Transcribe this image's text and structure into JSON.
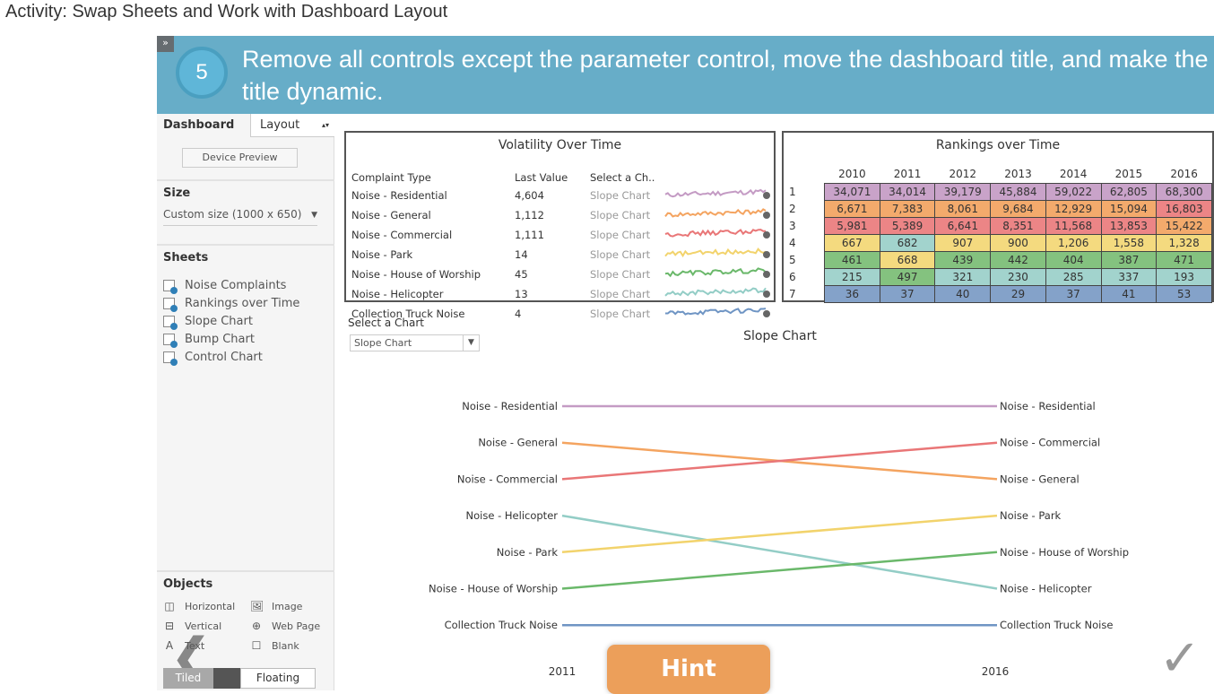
{
  "activity_title": "Activity: Swap Sheets and Work with Dashboard Layout",
  "step": {
    "number": "5",
    "instruction": "Remove all controls except the parameter control, move the dashboard title, and make the title dynamic.",
    "expand_icon": "double-chevron-right"
  },
  "sidebar": {
    "tabs": [
      "Dashboard",
      "Layout"
    ],
    "device_preview": "Device Preview",
    "size_label": "Size",
    "size_value": "Custom size (1000 x 650)",
    "sheets_label": "Sheets",
    "sheets": [
      "Noise Complaints",
      "Rankings over Time",
      "Slope Chart",
      "Bump Chart",
      "Control Chart"
    ],
    "objects_label": "Objects",
    "objects": [
      {
        "label": "Horizontal",
        "icon": "horizontal-container"
      },
      {
        "label": "Image",
        "icon": "image"
      },
      {
        "label": "Vertical",
        "icon": "vertical-container"
      },
      {
        "label": "Web Page",
        "icon": "globe"
      },
      {
        "label": "Text",
        "icon": "text"
      },
      {
        "label": "Blank",
        "icon": "blank"
      }
    ],
    "tiled": "Tiled",
    "floating": "Floating"
  },
  "volatility": {
    "title": "Volatility Over Time",
    "headers": [
      "Complaint Type",
      "Last Value",
      "Select a Ch.."
    ],
    "rows": [
      {
        "type": "Noise - Residential",
        "last": "4,604",
        "chart": "Slope Chart",
        "color": "#c49bc4"
      },
      {
        "type": "Noise - General",
        "last": "1,112",
        "chart": "Slope Chart",
        "color": "#f4a460"
      },
      {
        "type": "Noise - Commercial",
        "last": "1,111",
        "chart": "Slope Chart",
        "color": "#e97677"
      },
      {
        "type": "Noise - Park",
        "last": "14",
        "chart": "Slope Chart",
        "color": "#f2d36c"
      },
      {
        "type": "Noise - House of Worship",
        "last": "45",
        "chart": "Slope Chart",
        "color": "#6ab86a"
      },
      {
        "type": "Noise - Helicopter",
        "last": "13",
        "chart": "Slope Chart",
        "color": "#93cdc6"
      },
      {
        "type": "Collection Truck Noise",
        "last": "4",
        "chart": "Slope Chart",
        "color": "#6f95c4"
      }
    ]
  },
  "rankings": {
    "title": "Rankings over Time",
    "years": [
      "2010",
      "2011",
      "2012",
      "2013",
      "2014",
      "2015",
      "2016"
    ],
    "rows": [
      {
        "rank": "1",
        "values": [
          "34,071",
          "34,014",
          "39,179",
          "45,884",
          "59,022",
          "62,805",
          "68,300"
        ],
        "colors": [
          "P",
          "P",
          "P",
          "P",
          "P",
          "P",
          "P"
        ]
      },
      {
        "rank": "2",
        "values": [
          "6,671",
          "7,383",
          "8,061",
          "9,684",
          "12,929",
          "15,094",
          "16,803"
        ],
        "colors": [
          "O",
          "O",
          "O",
          "O",
          "O",
          "O",
          "R"
        ]
      },
      {
        "rank": "3",
        "values": [
          "5,981",
          "5,389",
          "6,641",
          "8,351",
          "11,568",
          "13,853",
          "15,422"
        ],
        "colors": [
          "R",
          "R",
          "R",
          "R",
          "R",
          "R",
          "O"
        ]
      },
      {
        "rank": "4",
        "values": [
          "667",
          "682",
          "907",
          "900",
          "1,206",
          "1,558",
          "1,328"
        ],
        "colors": [
          "Y",
          "T",
          "Y",
          "Y",
          "Y",
          "Y",
          "Y"
        ]
      },
      {
        "rank": "5",
        "values": [
          "461",
          "668",
          "439",
          "442",
          "404",
          "387",
          "471"
        ],
        "colors": [
          "G",
          "Y",
          "G",
          "G",
          "G",
          "G",
          "G"
        ]
      },
      {
        "rank": "6",
        "values": [
          "215",
          "497",
          "321",
          "230",
          "285",
          "337",
          "193"
        ],
        "colors": [
          "T",
          "G",
          "T",
          "T",
          "T",
          "T",
          "T"
        ]
      },
      {
        "rank": "7",
        "values": [
          "36",
          "37",
          "40",
          "29",
          "37",
          "41",
          "53"
        ],
        "colors": [
          "B",
          "B",
          "B",
          "B",
          "B",
          "B",
          "B"
        ]
      }
    ],
    "palette": {
      "P": "#c9a3c9",
      "O": "#f3aa6c",
      "R": "#ec8586",
      "Y": "#f4da7f",
      "G": "#84c27f",
      "T": "#a2d3cd",
      "B": "#84a2c9"
    }
  },
  "parameter": {
    "label": "Select a Chart",
    "value": "Slope Chart"
  },
  "slope": {
    "title": "Slope Chart",
    "start_label": "2011",
    "end_label": "2016",
    "left": [
      "Noise - Residential",
      "Noise - General",
      "Noise - Commercial",
      "Noise - Helicopter",
      "Noise - Park",
      "Noise - House of Worship",
      "Collection Truck Noise"
    ],
    "right": [
      "Noise - Residential",
      "Noise - Commercial",
      "Noise - General",
      "Noise - Park",
      "Noise - House of Worship",
      "Noise - Helicopter",
      "Collection Truck Noise"
    ],
    "colors": {
      "Noise - Residential": "#c49bc4",
      "Noise - General": "#f4a460",
      "Noise - Commercial": "#e97677",
      "Noise - Park": "#f2d36c",
      "Noise - House of Worship": "#6ab86a",
      "Noise - Helicopter": "#93cdc6",
      "Collection Truck Noise": "#6f95c4"
    }
  },
  "hint": "Hint",
  "nav": {
    "prev_icon": "chevron-left",
    "complete_icon": "checkmark"
  }
}
